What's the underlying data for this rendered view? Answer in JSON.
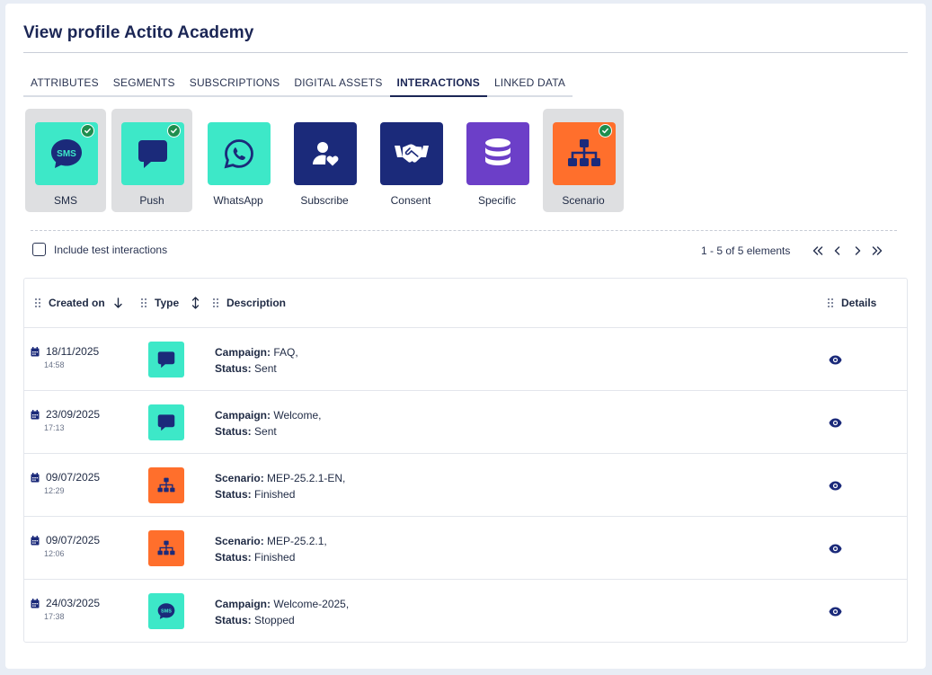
{
  "page": {
    "title": "View profile Actito Academy"
  },
  "tabs": [
    {
      "label": "ATTRIBUTES",
      "active": false
    },
    {
      "label": "SEGMENTS",
      "active": false
    },
    {
      "label": "SUBSCRIPTIONS",
      "active": false
    },
    {
      "label": "DIGITAL ASSETS",
      "active": false
    },
    {
      "label": "INTERACTIONS",
      "active": true
    },
    {
      "label": "LINKED DATA",
      "active": false
    }
  ],
  "interaction_types": [
    {
      "label": "SMS",
      "icon": "sms-icon",
      "color": "#3de8c8",
      "selected": true
    },
    {
      "label": "Push",
      "icon": "push-icon",
      "color": "#3de8c8",
      "selected": true
    },
    {
      "label": "WhatsApp",
      "icon": "whatsapp-icon",
      "color": "#3de8c8",
      "selected": false
    },
    {
      "label": "Subscribe",
      "icon": "subscribe-icon",
      "color": "#1b2a7a",
      "selected": false
    },
    {
      "label": "Consent",
      "icon": "handshake-icon",
      "color": "#1b2a7a",
      "selected": false
    },
    {
      "label": "Specific",
      "icon": "database-icon",
      "color": "#6c3fc8",
      "selected": false
    },
    {
      "label": "Scenario",
      "icon": "sitemap-icon",
      "color": "#ff6f2c",
      "selected": true
    }
  ],
  "filters": {
    "include_test_label": "Include test interactions",
    "include_test_checked": false
  },
  "pagination": {
    "summary": "1 - 5 of 5 elements"
  },
  "table": {
    "columns": {
      "created_on": "Created on",
      "type": "Type",
      "description": "Description",
      "details": "Details"
    },
    "rows": [
      {
        "date": "18/11/2025",
        "time": "14:58",
        "type": "push",
        "type_color": "#3de8c8",
        "desc_key": "Campaign:",
        "desc_value": "FAQ,",
        "status_key": "Status:",
        "status_value": "Sent"
      },
      {
        "date": "23/09/2025",
        "time": "17:13",
        "type": "push",
        "type_color": "#3de8c8",
        "desc_key": "Campaign:",
        "desc_value": "Welcome,",
        "status_key": "Status:",
        "status_value": "Sent"
      },
      {
        "date": "09/07/2025",
        "time": "12:29",
        "type": "scenario",
        "type_color": "#ff6f2c",
        "desc_key": "Scenario:",
        "desc_value": "MEP-25.2.1-EN,",
        "status_key": "Status:",
        "status_value": "Finished"
      },
      {
        "date": "09/07/2025",
        "time": "12:06",
        "type": "scenario",
        "type_color": "#ff6f2c",
        "desc_key": "Scenario:",
        "desc_value": "MEP-25.2.1,",
        "status_key": "Status:",
        "status_value": "Finished"
      },
      {
        "date": "24/03/2025",
        "time": "17:38",
        "type": "sms",
        "type_color": "#3de8c8",
        "desc_key": "Campaign:",
        "desc_value": "Welcome-2025,",
        "status_key": "Status:",
        "status_value": "Stopped"
      }
    ]
  },
  "colors": {
    "navy": "#1b2655",
    "teal": "#3de8c8",
    "orange": "#ff6f2c",
    "purple": "#6c3fc8",
    "check_green": "#1e8e4e"
  }
}
